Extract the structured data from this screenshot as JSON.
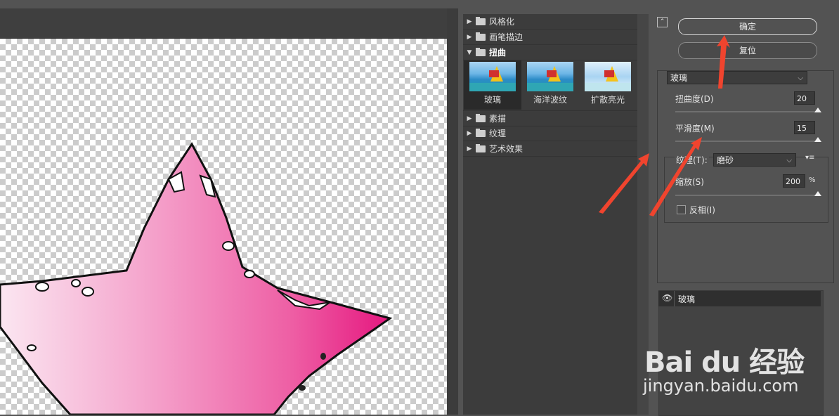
{
  "filter_categories_top": [
    {
      "label": "风格化",
      "open": false
    },
    {
      "label": "画笔描边",
      "open": false
    },
    {
      "label": "扭曲",
      "open": true
    }
  ],
  "distort_thumbnails": [
    {
      "label": "玻璃",
      "selected": true
    },
    {
      "label": "海洋波纹",
      "selected": false
    },
    {
      "label": "扩散亮光",
      "selected": false
    }
  ],
  "filter_categories_bottom": [
    {
      "label": "素描",
      "open": false
    },
    {
      "label": "纹理",
      "open": false
    },
    {
      "label": "艺术效果",
      "open": false
    }
  ],
  "buttons": {
    "ok": "确定",
    "reset": "复位"
  },
  "collapse_glyph": "⌃",
  "filter_select": {
    "value": "玻璃"
  },
  "params": {
    "distortion": {
      "label": "扭曲度(D)",
      "value": "20",
      "level": 1.0
    },
    "smoothness": {
      "label": "平滑度(M)",
      "value": "15",
      "level": 1.0
    },
    "texture": {
      "label": "纹理(T):",
      "value": "磨砂"
    },
    "scale": {
      "label": "缩放(S)",
      "value": "200",
      "unit": "%",
      "level": 1.0
    },
    "invert": {
      "label": "反相(I)",
      "checked": false
    }
  },
  "effect_layer": {
    "label": "玻璃"
  },
  "watermark": {
    "brand": "Bai du 经验",
    "url": "jingyan.baidu.com"
  },
  "colors": {
    "arrow": "#f0442e",
    "star": "#ec4f9c",
    "panel": "#535353",
    "list_bg": "#3c3c3c"
  }
}
